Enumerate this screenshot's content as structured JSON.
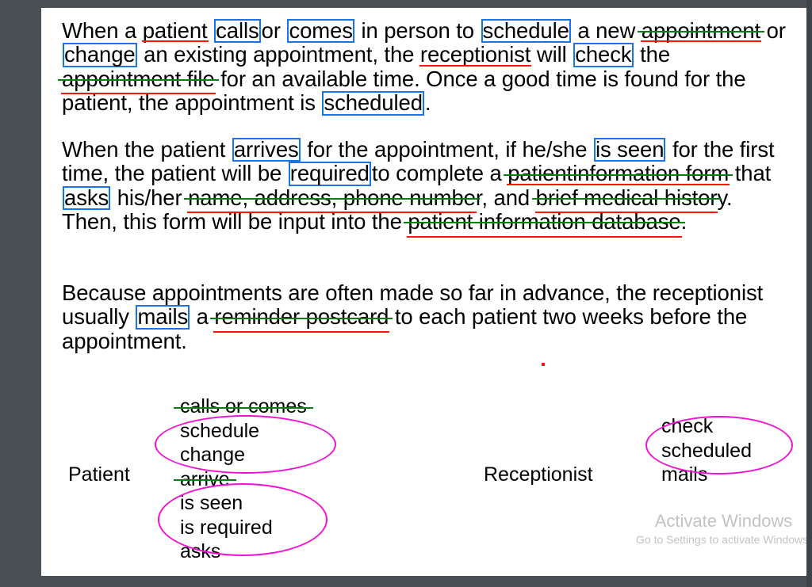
{
  "colors": {
    "blue_box": "#1874e8",
    "red_underline": "#fd1608",
    "green_strike": "#0a7d14",
    "magenta_ellipse": "#f210d6",
    "page_background": "#ffffff",
    "desktop_background": "#4a4f54",
    "text": "#000000",
    "watermark_text": "#c3c3c3"
  },
  "document": {
    "paragraph1": {
      "t1": "When a ",
      "noun_patient": "patient",
      "t2": " ",
      "verb_calls": "calls ",
      "t3": "or ",
      "verb_comes": "comes",
      "t4": " in person to ",
      "verb_schedule": "schedule",
      "t5": " a new ",
      "noun_appointment": "appointment",
      "t6": " or ",
      "verb_change": "change",
      "t7": " an existing appointment, the ",
      "noun_receptionist": "receptionist",
      "t8": " will ",
      "verb_check": "check",
      "t9": " the ",
      "noun_appointment_file": "appointment file",
      "t10": " for an available time. Once a good time is found for the patient, the appointment is ",
      "verb_scheduled": "scheduled",
      "t11": "."
    },
    "paragraph2": {
      "t1": "When the patient ",
      "verb_arrives": "arrives",
      "t2": " for the appointment, if he/she ",
      "verb_is_seen": "is seen",
      "t3": " for the first time, the patient will be ",
      "verb_required": "required ",
      "t4": "to complete a ",
      "noun_patient_info_form_a": "patient ",
      "noun_patient_info_form_b": "information form",
      "t5": " that ",
      "verb_asks": "asks",
      "t6": " his/her ",
      "noun_name_address_phone_a": "name, address, phone numbe",
      "noun_name_address_phone_b": "r",
      "t7": ", and ",
      "noun_brief_medical_history_a": "brief medical histor",
      "noun_brief_medical_history_b": "y",
      "t8": ". Then, this form will be input into the ",
      "noun_patient_info_database": "patient information database",
      "t9": "."
    },
    "paragraph3": {
      "t1": "Because appointments are often made so far in advance, the receptionist usually ",
      "verb_mails": "mails",
      "t2": " a ",
      "noun_reminder_postcard": "reminder postcard",
      "t3": " to each patient two weeks before the appointment."
    }
  },
  "diagram": {
    "actors": [
      {
        "name": "Patient"
      },
      {
        "name": "Receptionist"
      }
    ],
    "patient_verbs": [
      {
        "text": "calls or comes",
        "struck": true,
        "circled": false
      },
      {
        "text": "schedule",
        "struck": false,
        "circled": true
      },
      {
        "text": "change",
        "struck": false,
        "circled": true
      },
      {
        "text": "arrive",
        "struck": true,
        "circled": false
      },
      {
        "text": "is seen",
        "struck": false,
        "circled": true
      },
      {
        "text": "is required",
        "struck": false,
        "circled": true
      },
      {
        "text": "asks",
        "struck": false,
        "circled": true
      }
    ],
    "receptionist_verbs": [
      {
        "text": "check",
        "struck": false,
        "circled": true
      },
      {
        "text": "scheduled",
        "struck": false,
        "circled": true
      },
      {
        "text": "mails",
        "struck": false,
        "circled": false
      }
    ]
  },
  "watermark": {
    "title": "Activate Windows",
    "subtitle": "Go to Settings to activate Windows."
  }
}
